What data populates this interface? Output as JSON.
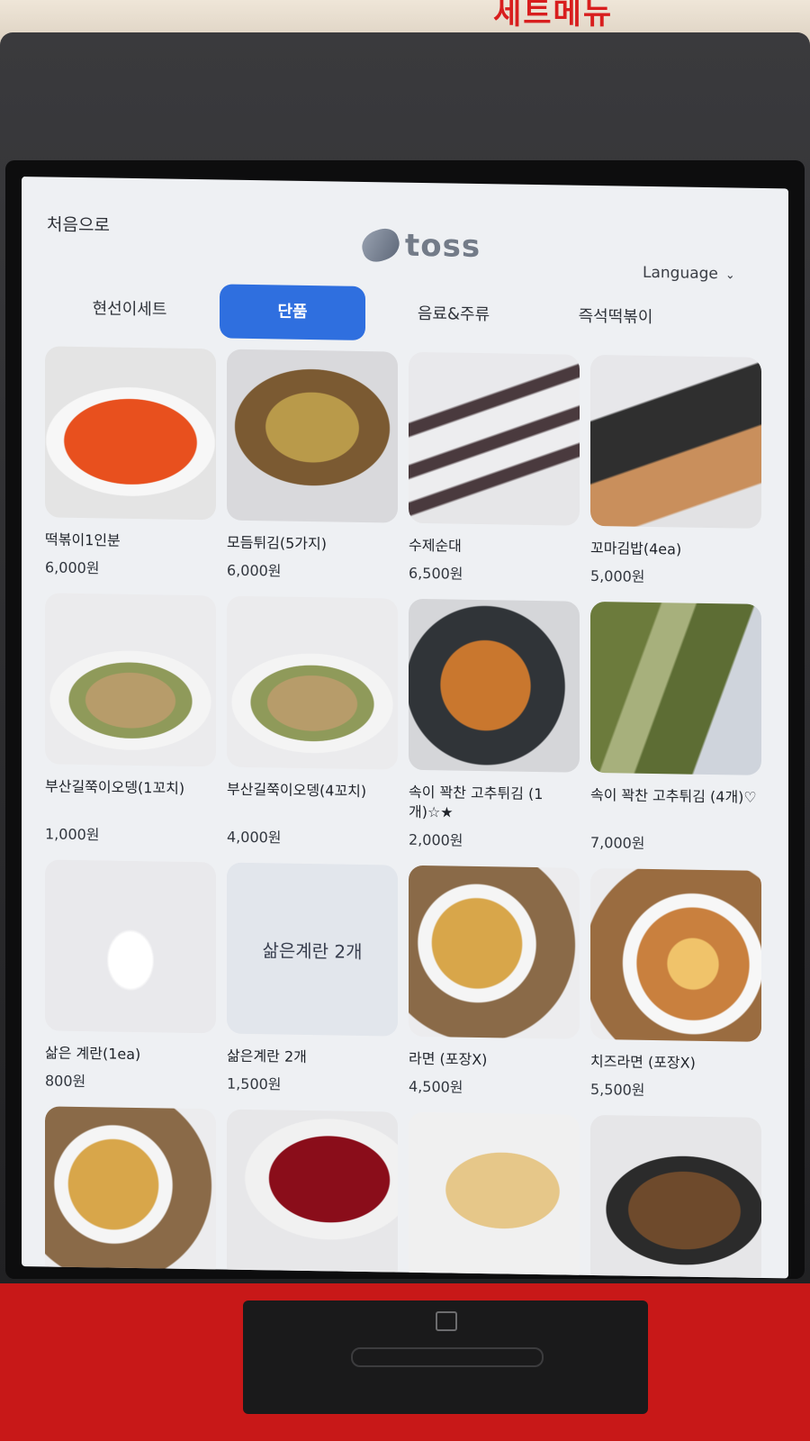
{
  "environment": {
    "wall_sign": "세트메뉴"
  },
  "header": {
    "home_label": "처음으로",
    "logo_text": "toss",
    "language_label": "Language"
  },
  "tabs": [
    {
      "label": "현선이세트",
      "active": false
    },
    {
      "label": "단품",
      "active": true
    },
    {
      "label": "음료&주류",
      "active": false
    },
    {
      "label": "즉석떡볶이",
      "active": false
    }
  ],
  "menu": [
    {
      "name": "떡볶이1인분",
      "price": "6,000원",
      "photo": "tteokbokki"
    },
    {
      "name": "모듬튀김(5가지)",
      "price": "6,000원",
      "photo": "fried-assortment"
    },
    {
      "name": "수제순대",
      "price": "6,500원",
      "photo": "sundae"
    },
    {
      "name": "꼬마김밥(4ea)",
      "price": "5,000원",
      "photo": "mini-gimbap"
    },
    {
      "name": "부산길쭉이오뎅(1꼬치)",
      "price": "1,000원",
      "photo": "fishcake-skewer"
    },
    {
      "name": "부산길쭉이오뎅(4꼬치)",
      "price": "4,000원",
      "photo": "fishcake-skewers"
    },
    {
      "name": "속이 꽉찬 고추튀김 (1개)☆★",
      "price": "2,000원",
      "photo": "fried-pepper"
    },
    {
      "name": "속이 꽉찬 고추튀김 (4개)♡",
      "price": "7,000원",
      "photo": "fried-peppers"
    },
    {
      "name": "삶은 계란(1ea)",
      "price": "800원",
      "photo": "boiled-egg"
    },
    {
      "name": "삶은계란 2개",
      "price": "1,500원",
      "photo": "text-only",
      "photo_text": "삶은계란 2개"
    },
    {
      "name": "라면 (포장X)",
      "price": "4,500원",
      "photo": "ramen"
    },
    {
      "name": "치즈라면 (포장X)",
      "price": "5,500원",
      "photo": "cheese-ramen"
    },
    {
      "name": "",
      "price": "",
      "photo": "ramen"
    },
    {
      "name": "",
      "price": "",
      "photo": "sauce"
    },
    {
      "name": "",
      "price": "",
      "photo": "dumplings"
    },
    {
      "name": "",
      "price": "",
      "photo": "okonomiyaki"
    }
  ],
  "colors": {
    "accent": "#2f6fdf",
    "screen_bg": "#eef0f3",
    "kiosk_red": "#c81818"
  }
}
